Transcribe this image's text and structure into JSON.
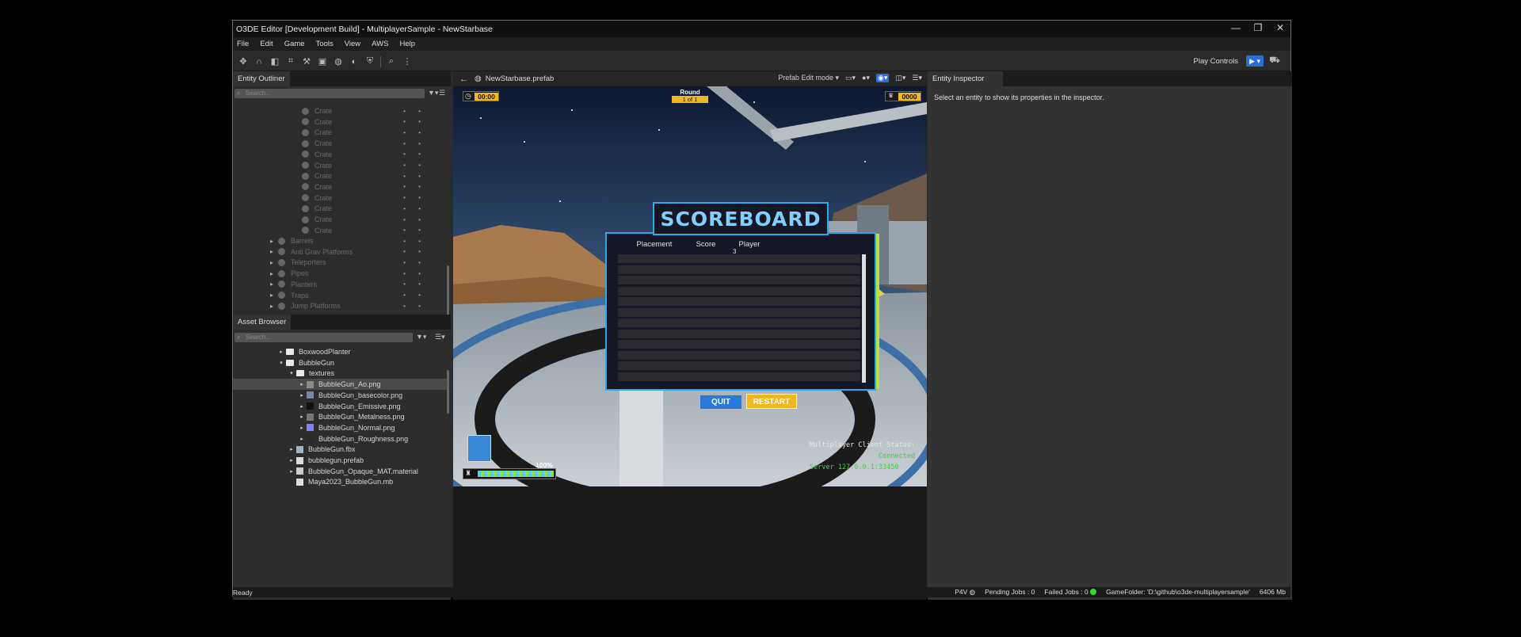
{
  "window": {
    "title": "O3DE Editor [Development Build] - MultiplayerSample - NewStarbase",
    "controls": [
      "—",
      "❐",
      "✕"
    ]
  },
  "menu": [
    "File",
    "Edit",
    "Game",
    "Tools",
    "View",
    "AWS",
    "Help"
  ],
  "toolbar": {
    "play_controls_label": "Play Controls"
  },
  "outliner": {
    "title": "Entity Outliner",
    "search_placeholder": "Search...",
    "crates": [
      "Crate",
      "Crate",
      "Crate",
      "Crate",
      "Crate",
      "Crate",
      "Crate",
      "Crate",
      "Crate",
      "Crate",
      "Crate",
      "Crate"
    ],
    "groups": [
      "Barrels",
      "Anti Grav Platforms",
      "Teleporters",
      "Pipes",
      "Planters",
      "Traps",
      "Jump Platforms"
    ]
  },
  "assets": {
    "title": "Asset Browser",
    "search_placeholder": "Search...",
    "rows": [
      {
        "label": "BoxwoodPlanter",
        "indent": 0,
        "type": "folder",
        "caret": "▸"
      },
      {
        "label": "BubbleGun",
        "indent": 0,
        "type": "folder",
        "caret": "▾"
      },
      {
        "label": "textures",
        "indent": 1,
        "type": "folder",
        "caret": "▾"
      },
      {
        "label": "BubbleGun_Ao.png",
        "indent": 2,
        "type": "img",
        "caret": "▸",
        "selected": true,
        "color": "#8a8a8a"
      },
      {
        "label": "BubbleGun_basecolor.png",
        "indent": 2,
        "type": "img",
        "caret": "▸",
        "color": "#7a86a0"
      },
      {
        "label": "BubbleGun_Emissive.png",
        "indent": 2,
        "type": "img",
        "caret": "▸",
        "color": "#111111"
      },
      {
        "label": "BubbleGun_Metalness.png",
        "indent": 2,
        "type": "img",
        "caret": "▸",
        "color": "#777777"
      },
      {
        "label": "BubbleGun_Normal.png",
        "indent": 2,
        "type": "img",
        "caret": "▸",
        "color": "#8080ff"
      },
      {
        "label": "BubbleGun_Roughness.png",
        "indent": 2,
        "type": "img",
        "caret": "▸",
        "color": "#2a2a2a"
      },
      {
        "label": "BubbleGun.fbx",
        "indent": 1,
        "type": "fbx",
        "caret": "▸",
        "color": "#9fb4c8"
      },
      {
        "label": "bubblegun.prefab",
        "indent": 1,
        "type": "file",
        "caret": "▸",
        "color": "#dddddd"
      },
      {
        "label": "BubbleGun_Opaque_MAT.material",
        "indent": 1,
        "type": "mat",
        "caret": "▸",
        "color": "#cccccc"
      },
      {
        "label": "Maya2023_BubbleGun.mb",
        "indent": 1,
        "type": "file",
        "caret": "",
        "color": "#dddddd"
      }
    ]
  },
  "viewport": {
    "prefab_name": "NewStarbase.prefab",
    "mode": "Prefab Edit mode",
    "hud": {
      "timer": "00:00",
      "round_label": "Round",
      "round_value": "1 of 1",
      "coins": "0000",
      "health": "100%",
      "health_level": 1.0
    },
    "scoreboard": {
      "title": "SCOREBOARD",
      "columns": [
        "Placement",
        "Score",
        "Player"
      ],
      "first_value": "3",
      "quit": "QUIT",
      "restart": "RESTART"
    },
    "mp_status": {
      "line1": "Multiplayer Client Status:",
      "line2": "Connected",
      "line3": "Server 127.0.0.1:33450"
    }
  },
  "inspector": {
    "title": "Entity Inspector",
    "empty_text": "Select an entity to show its properties in the inspector."
  },
  "status": {
    "ready": "Ready",
    "p4v": "P4V",
    "pending": "Pending Jobs : 0",
    "failed": "Failed Jobs : 0",
    "gamefolder": "GameFolder: 'D:\\github\\o3de-multiplayersample'",
    "memory": "6406 Mb"
  }
}
